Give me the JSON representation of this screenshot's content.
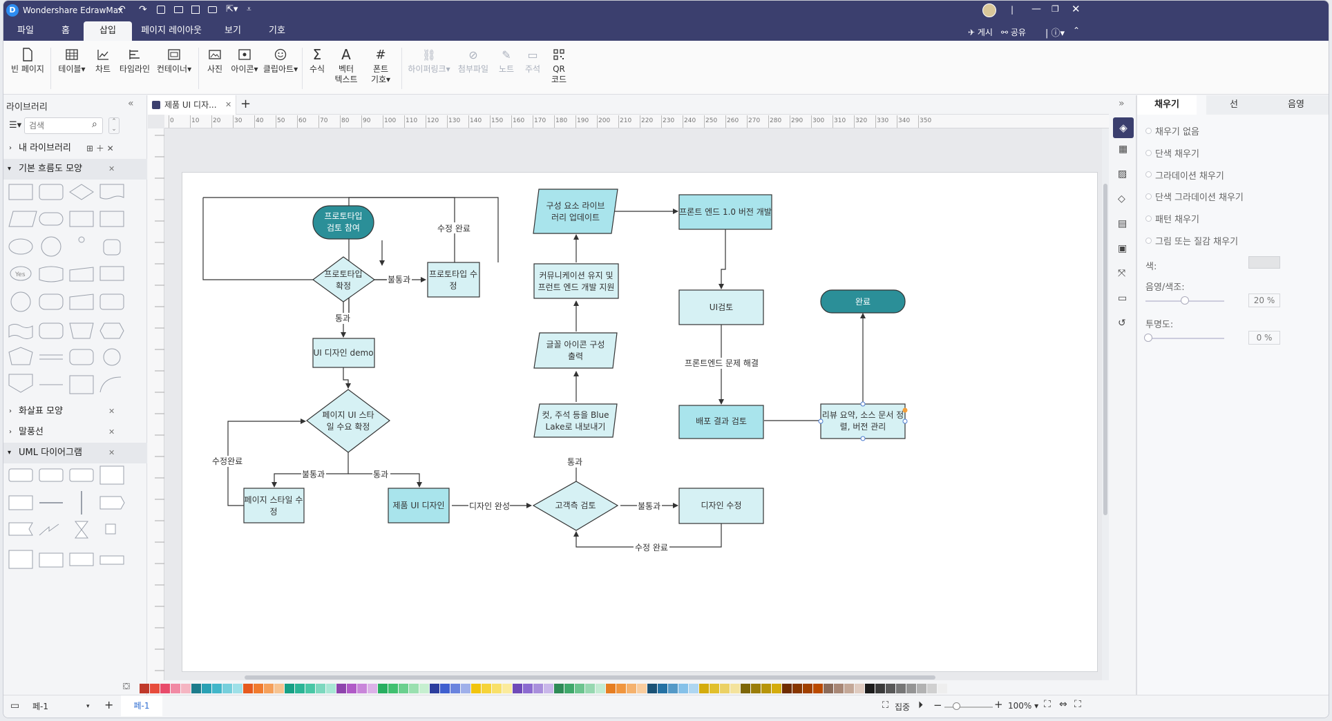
{
  "app": {
    "title": "Wondershare EdrawMax"
  },
  "titlebar": {
    "publish": "게시",
    "share": "공유"
  },
  "menu": {
    "tabs": [
      "파일",
      "홈",
      "삽입",
      "페이지 레이아웃",
      "보기",
      "기호"
    ],
    "active": 2
  },
  "ribbon": {
    "blank_page": "빈 페이지",
    "table": "테이블",
    "chart": "차트",
    "timeline": "타임라인",
    "container": "컨테이너",
    "photo": "사진",
    "icon": "아이콘",
    "clipart": "클립아트",
    "formula": "수식",
    "vector_text_1": "벡터",
    "vector_text_2": "텍스트",
    "font_symbol_1": "폰트",
    "font_symbol_2": "기호",
    "hyperlink": "하이퍼링크",
    "attachment": "첨부파일",
    "note": "노트",
    "comment": "주석",
    "qr_1": "QR",
    "qr_2": "코드"
  },
  "library": {
    "title": "라이브러리",
    "search_placeholder": "검색",
    "my_library": "내 라이브러리",
    "sections": [
      "기본 흐름도 모양",
      "화살표 모양",
      "말풍선",
      "UML 다이어그램"
    ],
    "yes_label": "Yes"
  },
  "doc": {
    "tab_title": "제품 UI 디자...",
    "ruler_marks": [
      "0",
      "10",
      "20",
      "30",
      "40",
      "50",
      "60",
      "70",
      "80",
      "90",
      "100",
      "110",
      "120",
      "130",
      "140",
      "150",
      "160",
      "170",
      "180",
      "190",
      "200",
      "210",
      "220",
      "230",
      "240",
      "250",
      "260",
      "270",
      "280",
      "290",
      "300",
      "310",
      "320",
      "330",
      "340",
      "350"
    ]
  },
  "flow": {
    "n_start": [
      "프로토타입",
      "검토 참여"
    ],
    "n_confirm": [
      "프로토타입",
      "확정"
    ],
    "n_proto_edit": [
      "프로토타입 수",
      "정"
    ],
    "n_ui_demo": "UI 디자인 demo",
    "n_style_confirm": [
      "페이지 UI 스타",
      "일 수요 확정"
    ],
    "n_style_edit": [
      "페이지 스타일 수",
      "정"
    ],
    "n_product_ui": "제품 UI 디자인",
    "n_customer": "고객측 검토",
    "n_design_edit": "디자인 수정",
    "n_export": [
      "컷, 주석 등을 Blue",
      "Lake로 내보내기"
    ],
    "n_icon": [
      "글꼴 아이콘 구성",
      "출력"
    ],
    "n_comm": [
      "커뮤니케이션 유지 및",
      "프런트 엔드 개발 지원"
    ],
    "n_lib": [
      "구성 요소 라이브",
      "러리 업데이트"
    ],
    "n_fe": "프론트 엔드 1.0 버전 개발",
    "n_uicheck": "UI검토",
    "n_deploy": "배포 결과 검토",
    "n_review": [
      "리뷰 요약, 소스 문서 정",
      "렬, 버전 관리"
    ],
    "n_done": "완료",
    "l_edit_done": "수정 완료",
    "l_fail": "불통과",
    "l_pass": "통과",
    "l_edit_done2": "수정완료",
    "l_fail2": "불통과",
    "l_pass2": "통과",
    "l_design_done": "디자인 완성",
    "l_fail3": "불통과",
    "l_edit_done3": "수정 완료",
    "l_pass3": "통과",
    "l_fe_issue": "프론트엔드 문제 해결"
  },
  "panel": {
    "tabs": [
      "채우기",
      "선",
      "음영"
    ],
    "options": [
      "채우기 없음",
      "단색 채우기",
      "그라데이션 채우기",
      "단색 그라데이션 채우기",
      "패턴 채우기",
      "그림 또는 질감 채우기"
    ],
    "color_label": "색:",
    "shade_label": "음영/색조:",
    "shade_value": "20 %",
    "transparency_label": "투명도:",
    "transparency_value": "0 %",
    "shade_level": 0.5,
    "transparency_level": 0.0
  },
  "status": {
    "page_select": "페-1",
    "page_tab": "페-1",
    "focus": "집중",
    "zoom": "100%"
  },
  "colors": {
    "accent": "#3b3f6e",
    "node_dark": "#2b8f98",
    "node_light": "#d6f1f4",
    "node_mid": "#a9e4ec",
    "stroke": "#333333"
  }
}
